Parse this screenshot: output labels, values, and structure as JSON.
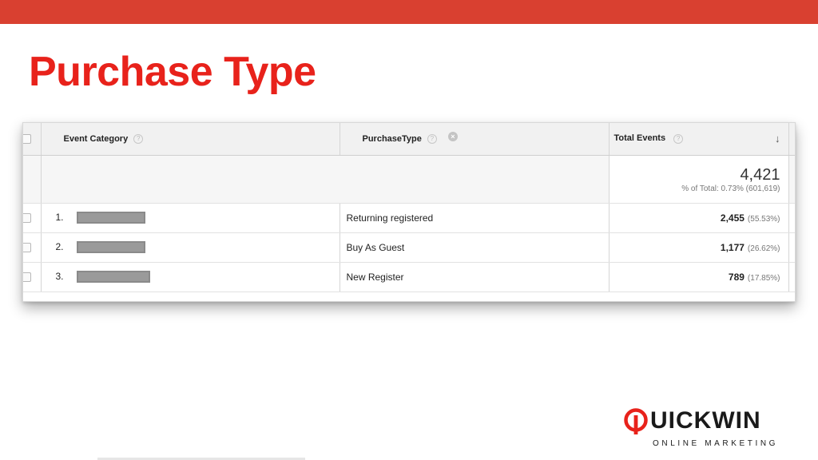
{
  "colors": {
    "accent": "#d94030",
    "title": "#e8221b"
  },
  "slide": {
    "title": "Purchase Type"
  },
  "table": {
    "headers": {
      "event_category": "Event Category",
      "purchase_type": "PurchaseType",
      "total_events": "Total Events",
      "help_glyph": "?",
      "remove_glyph": "×",
      "sort_glyph": "↓"
    },
    "summary": {
      "total": "4,421",
      "pct_of_total": "% of Total: 0.73% (601,619)"
    },
    "rows": [
      {
        "index": "1.",
        "event_category_redacted": true,
        "purchase_type": "Returning registered",
        "total": "2,455",
        "pct": "(55.53%)"
      },
      {
        "index": "2.",
        "event_category_redacted": true,
        "purchase_type": "Buy As Guest",
        "total": "1,177",
        "pct": "(26.62%)"
      },
      {
        "index": "3.",
        "event_category_redacted": true,
        "purchase_type": "New Register",
        "total": "789",
        "pct": "(17.85%)"
      }
    ]
  },
  "logo": {
    "word": "UICKWIN",
    "subtitle": "ONLINE MARKETING",
    "icon": "q-logo-icon"
  }
}
